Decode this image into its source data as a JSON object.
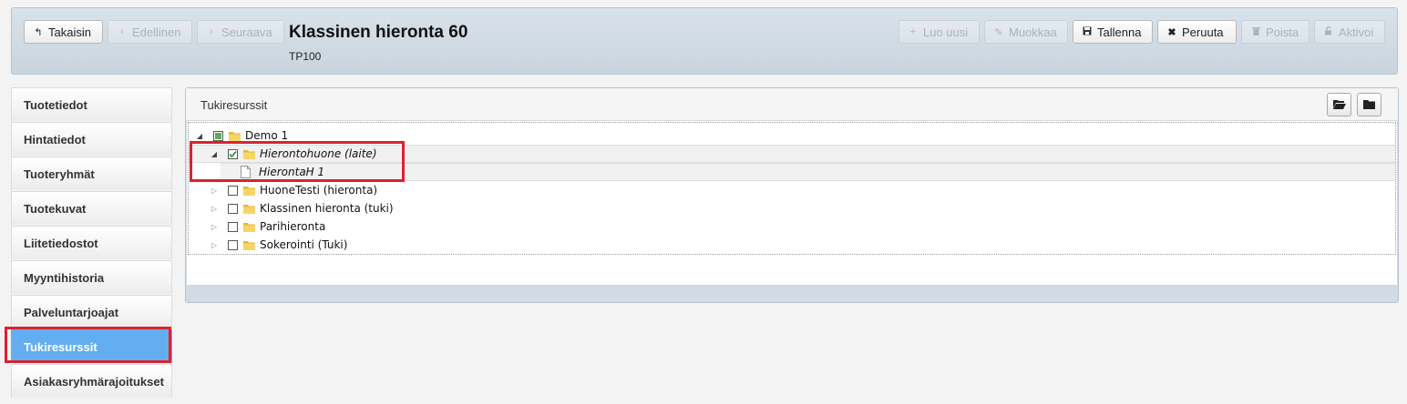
{
  "header": {
    "back_label": "Takaisin",
    "prev_label": "Edellinen",
    "next_label": "Seuraava",
    "title": "Klassinen hieronta 60",
    "code": "TP100",
    "new_label": "Luo uusi",
    "edit_label": "Muokkaa",
    "save_label": "Tallenna",
    "cancel_label": "Peruuta",
    "delete_label": "Poista",
    "activate_label": "Aktivoi"
  },
  "sidebar": {
    "items": [
      {
        "label": "Tuotetiedot"
      },
      {
        "label": "Hintatiedot"
      },
      {
        "label": "Tuoteryhmät"
      },
      {
        "label": "Tuotekuvat"
      },
      {
        "label": "Liitetiedostot"
      },
      {
        "label": "Myyntihistoria"
      },
      {
        "label": "Palveluntarjoajat"
      },
      {
        "label": "Tukiresurssit",
        "active": true
      },
      {
        "label": "Asiakasryhmärajoitukset"
      }
    ]
  },
  "panel": {
    "title": "Tukiresurssit",
    "tree": [
      {
        "label": "Demo 1",
        "checked": "partial",
        "expanded": true
      },
      {
        "label": "Hierontohuone (laite)",
        "checked": true,
        "expanded": true
      },
      {
        "label": "HierontaH 1"
      },
      {
        "label": "HuoneTesti (hieronta)",
        "checked": false
      },
      {
        "label": "Klassinen hieronta (tuki)",
        "checked": false
      },
      {
        "label": "Parihieronta",
        "checked": false
      },
      {
        "label": "Sokerointi (Tuki)",
        "checked": false
      }
    ]
  },
  "colors": {
    "accent": "#63aef1",
    "highlight": "#d9232e"
  }
}
